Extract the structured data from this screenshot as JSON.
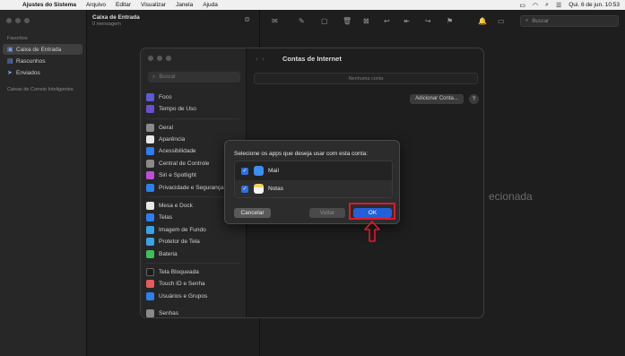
{
  "menubar": {
    "app_name": "Ajustes do Sistema",
    "items": [
      "Arquivo",
      "Editar",
      "Visualizar",
      "Janela",
      "Ajuda"
    ],
    "date_time": "Qui. 6 de jun. 10:53"
  },
  "mail": {
    "sidebar": {
      "favorites_label": "Favoritos",
      "items": [
        {
          "label": "Caixa de Entrada",
          "icon": "inbox-icon"
        },
        {
          "label": "Rascunhos",
          "icon": "document-icon"
        },
        {
          "label": "Enviados",
          "icon": "paperplane-icon"
        }
      ],
      "smart_label": "Caixas de Correio Inteligentes"
    },
    "list": {
      "title": "Caixa de Entrada",
      "subtitle": "0 mensagem"
    },
    "search_placeholder": "Buscar",
    "viewer_text": "ecionada"
  },
  "settings": {
    "title": "Contas de Internet",
    "search_placeholder": "Buscar",
    "no_account": "Nenhuma conta",
    "add_account": "Adicionar Conta...",
    "help": "?",
    "sidebar_items": [
      {
        "label": "Foco",
        "color": "#5b5bd6"
      },
      {
        "label": "Tempo de Uso",
        "color": "#6b4fd0"
      },
      {
        "label": "Geral",
        "color": "#8a8a8a"
      },
      {
        "label": "Aparência",
        "color": "#1b1b1b"
      },
      {
        "label": "Acessibilidade",
        "color": "#2d7ff0"
      },
      {
        "label": "Central de Controle",
        "color": "#8a8a8a"
      },
      {
        "label": "Siri e Spotlight",
        "color": "#c04fd8"
      },
      {
        "label": "Privacidade e Segurança",
        "color": "#2d7ff0"
      },
      {
        "label": "Mesa e Dock",
        "color": "#1b1b1b"
      },
      {
        "label": "Telas",
        "color": "#2d7ff0"
      },
      {
        "label": "Imagem de Fundo",
        "color": "#3aa3e8"
      },
      {
        "label": "Protetor de Tela",
        "color": "#3aa3e8"
      },
      {
        "label": "Bateria",
        "color": "#3fbf5a"
      },
      {
        "label": "Tela Bloqueada",
        "color": "#1b1b1b"
      },
      {
        "label": "Touch ID e Senha",
        "color": "#e85a5a"
      },
      {
        "label": "Usuários e Grupos",
        "color": "#2d7ff0"
      },
      {
        "label": "Senhas",
        "color": "#8a8a8a"
      }
    ]
  },
  "dialog": {
    "message": "Selecione os apps que deseja usar com esta conta:",
    "apps": [
      {
        "name": "Mail",
        "checked": true,
        "color": "#3c8ef0"
      },
      {
        "name": "Notas",
        "checked": true,
        "color": "#f5d35a"
      }
    ],
    "cancel_label": "Cancelar",
    "back_label": "Voltar",
    "ok_label": "OK"
  }
}
